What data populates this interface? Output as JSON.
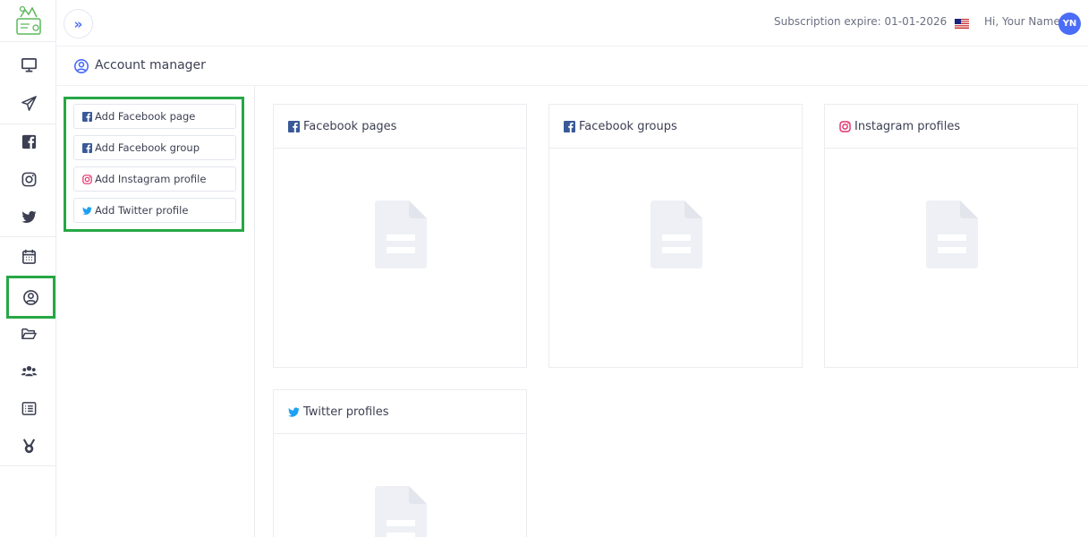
{
  "header": {
    "subscription_text": "Subscription expire: 01-01-2026",
    "greeting": "Hi, Your Name",
    "avatar_initials": "YN"
  },
  "page": {
    "title": "Account manager"
  },
  "sidebar": {
    "items": [
      {
        "name": "sidebar-item-dashboard",
        "icon": "monitor-icon"
      },
      {
        "name": "sidebar-item-publish",
        "icon": "paper-plane-icon"
      },
      {
        "name": "sidebar-item-facebook",
        "icon": "facebook-icon"
      },
      {
        "name": "sidebar-item-instagram",
        "icon": "instagram-icon"
      },
      {
        "name": "sidebar-item-twitter",
        "icon": "twitter-icon"
      },
      {
        "name": "sidebar-item-calendar",
        "icon": "calendar-icon"
      },
      {
        "name": "sidebar-item-account-manager",
        "icon": "user-circle-icon",
        "active": true
      },
      {
        "name": "sidebar-item-files",
        "icon": "folder-open-icon"
      },
      {
        "name": "sidebar-item-users",
        "icon": "users-icon"
      },
      {
        "name": "sidebar-item-list",
        "icon": "list-icon"
      },
      {
        "name": "sidebar-item-awards",
        "icon": "medal-icon"
      }
    ]
  },
  "add_buttons": {
    "facebook_page": "Add Facebook page",
    "facebook_group": "Add Facebook group",
    "instagram_profile": "Add Instagram profile",
    "twitter_profile": "Add Twitter profile"
  },
  "cards": {
    "facebook_pages": "Facebook pages",
    "facebook_groups": "Facebook groups",
    "instagram_profiles": "Instagram profiles",
    "twitter_profiles": "Twitter profiles"
  },
  "colors": {
    "accent": "#4a6cf7",
    "highlight": "#27a745",
    "facebook": "#3b5998",
    "instagram": "#e1306c",
    "twitter": "#1da1f2",
    "sidebar_icon": "#3c3f52",
    "empty_icon": "#eef0f5"
  }
}
